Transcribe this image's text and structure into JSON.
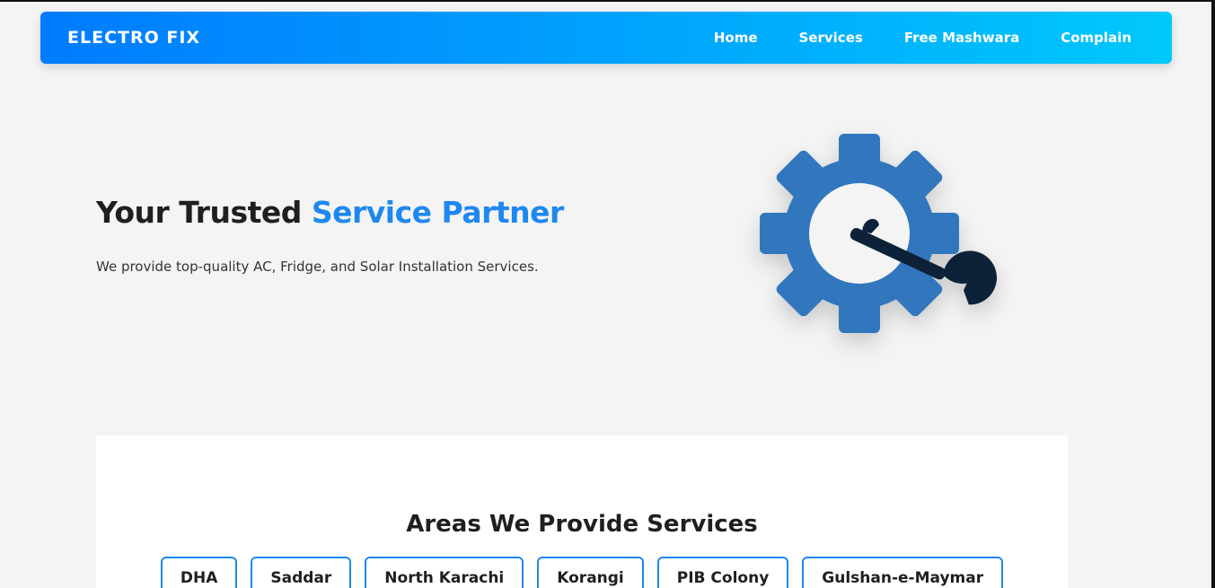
{
  "navbar": {
    "brand": "ELECTRO FIX",
    "links": [
      "Home",
      "Services",
      "Free Mashwara",
      "Complain"
    ]
  },
  "hero": {
    "title_plain": "Your Trusted ",
    "title_accent": "Service Partner",
    "subtitle": "We provide top-quality AC, Fridge, and Solar Installation Services.",
    "image_icon": "gear-wrench-icon"
  },
  "areas": {
    "title": "Areas We Provide Services",
    "items": [
      "DHA",
      "Saddar",
      "North Karachi",
      "Korangi",
      "PIB Colony",
      "Gulshan-e-Maymar"
    ]
  },
  "colors": {
    "accent": "#1e88f0",
    "nav_gradient_start": "#007bff",
    "nav_gradient_end": "#00c8fb",
    "gear": "#3077be",
    "wrench": "#0d2238"
  }
}
